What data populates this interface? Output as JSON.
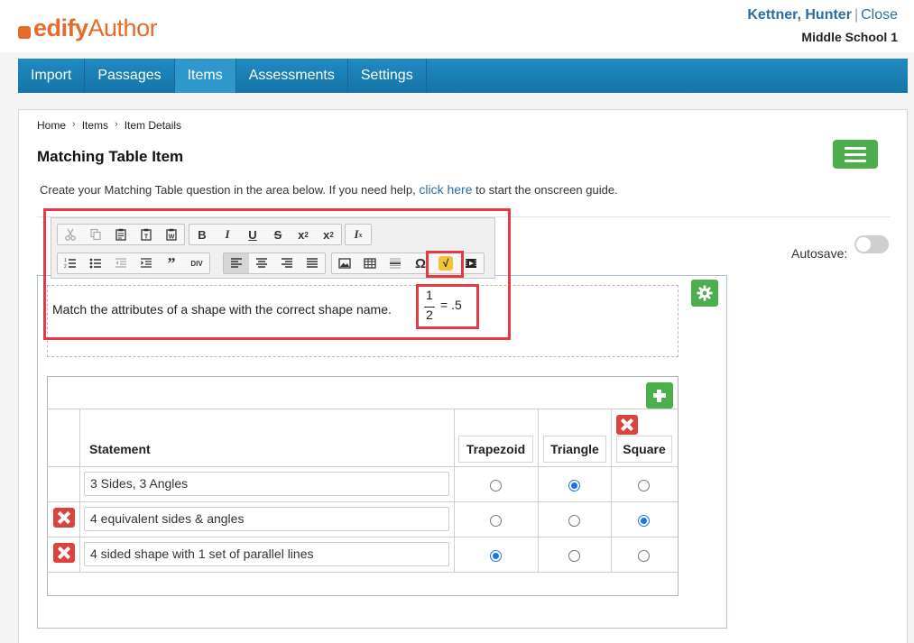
{
  "brand": {
    "logo_bold": "edify",
    "logo_light": "Author",
    "accent": "#e86a2b"
  },
  "user": {
    "name": "Kettner, Hunter",
    "separator": "|",
    "close_label": "Close",
    "school": "Middle School 1"
  },
  "nav": {
    "items": [
      {
        "label": "Import"
      },
      {
        "label": "Passages"
      },
      {
        "label": "Items",
        "active": true
      },
      {
        "label": "Assessments"
      },
      {
        "label": "Settings"
      }
    ]
  },
  "breadcrumb": {
    "items": [
      "Home",
      "Items",
      "Item Details"
    ],
    "separator": "›"
  },
  "page": {
    "title": "Matching Table Item",
    "instructions_before": "Create your Matching Table question in the area below. If you need help, ",
    "instructions_link": "click here",
    "instructions_after": " to start the onscreen guide.",
    "autosave_label": "Autosave:",
    "autosave_on": false
  },
  "toolbar": {
    "icons_row1": [
      "cut-icon",
      "copy-icon",
      "paste-icon",
      "paste-text-icon",
      "paste-word-icon",
      "bold-icon",
      "italic-icon",
      "underline-icon",
      "strikethrough-icon",
      "subscript-icon",
      "superscript-icon",
      "remove-format-icon"
    ],
    "icons_row2": [
      "numbered-list-icon",
      "bulleted-list-icon",
      "outdent-icon",
      "indent-icon",
      "blockquote-icon",
      "div-icon",
      "align-left-icon",
      "align-center-icon",
      "align-right-icon",
      "justify-icon",
      "image-icon",
      "table-icon",
      "horizontal-line-icon",
      "special-char-icon",
      "math-equation-icon",
      "video-icon"
    ],
    "div_label": "DIV",
    "omega": "Ω",
    "math_label": "√"
  },
  "question": {
    "text": "Match the attributes of a shape with the correct shape name.",
    "fraction_num": "1",
    "fraction_den": "2",
    "fraction_eq": "= .5"
  },
  "table": {
    "statement_header": "Statement",
    "columns": [
      "Trapezoid",
      "Triangle",
      "Square"
    ],
    "rows": [
      {
        "statement": "3 Sides, 3 Angles",
        "selected": 1,
        "deletable": false
      },
      {
        "statement": "4 equivalent sides & angles",
        "selected": 2,
        "deletable": true
      },
      {
        "statement": "4 sided shape with 1 set of parallel lines",
        "selected": 0,
        "deletable": true
      }
    ]
  },
  "colors": {
    "nav": "#1674a6",
    "green": "#4cae4c",
    "red": "#d9443f",
    "highlight": "#e53a45",
    "link": "#2a6ea8"
  }
}
